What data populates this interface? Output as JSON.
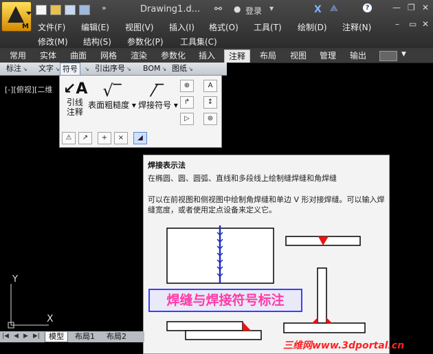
{
  "app": {
    "logo_letter": "M",
    "title": "Drawing1.d...",
    "login_label": "登录",
    "help_label": "?",
    "quick_access_more": "»"
  },
  "menu": {
    "row1": [
      "文件(F)",
      "编辑(E)",
      "视图(V)",
      "插入(I)",
      "格式(O)",
      "工具(T)",
      "绘制(D)",
      "注释(N)"
    ],
    "row2": [
      "修改(M)",
      "结构(S)",
      "参数化(P)",
      "工具集(C)"
    ]
  },
  "ribbon_tabs": [
    "常用",
    "实体",
    "曲面",
    "网格",
    "渲染",
    "参数化",
    "插入",
    "注释",
    "布局",
    "视图",
    "管理",
    "输出"
  ],
  "active_tab": "注释",
  "panel_bar": [
    "标注",
    "文字",
    "符号",
    "引出序号",
    "BOM",
    "图纸"
  ],
  "active_panel": "符号",
  "symbol_panel": {
    "leader_label_1": "引线",
    "leader_label_2": "注释",
    "surface_label": "表面粗糙度",
    "weld_label": "焊接符号"
  },
  "viewport_label": "[-][俯视][二维",
  "tooltip": {
    "title": "焊接表示法",
    "description": "在椭圆、圆、圆弧、直线和多段线上绘制缝焊缝和角焊缝",
    "body": "可以在前视图和侧视图中绘制角焊缝和单边 V 形对接焊缝。可以输入焊缝宽度，或者使用定点设备来定义它。",
    "banner": "焊缝与焊接符号标注"
  },
  "layout_tabs": [
    "模型",
    "布局1",
    "布局2"
  ],
  "active_layout": "模型",
  "watermark": "三维网www.3dportal.cn",
  "colors": {
    "weld_blue": "#1e2dbf",
    "weld_red": "#e81414",
    "banner_text": "#ff3aa8",
    "banner_border": "#3c3cff"
  }
}
